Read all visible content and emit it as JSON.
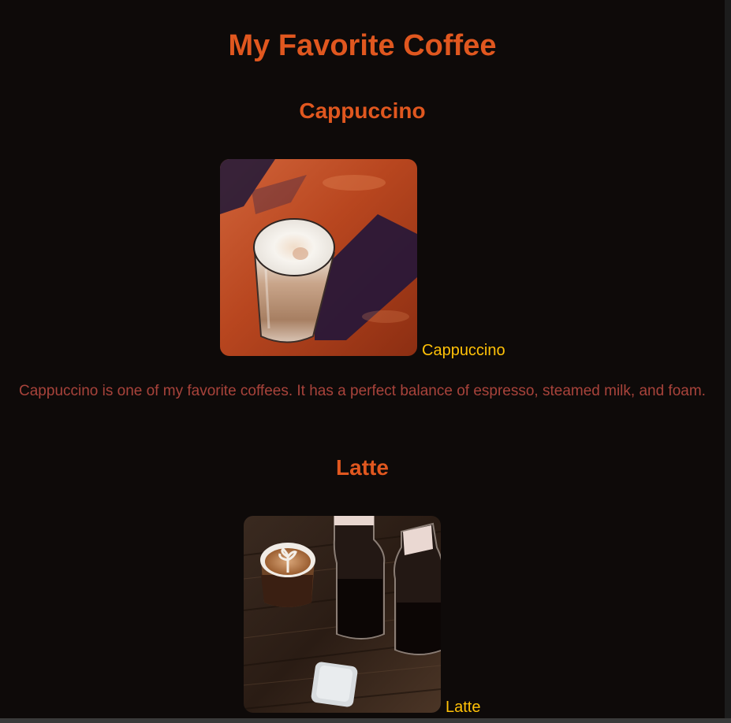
{
  "page": {
    "title": "My Favorite Coffee"
  },
  "sections": [
    {
      "heading": "Cappuccino",
      "caption": "Cappuccino",
      "description": "Cappuccino is one of my favorite coffees. It has a perfect balance of espresso, steamed milk, and foam."
    },
    {
      "heading": "Latte",
      "caption": "Latte"
    }
  ],
  "colors": {
    "background": "#0e0a09",
    "heading": "#e0571f",
    "caption": "#ffc107",
    "description": "#a8433b"
  }
}
